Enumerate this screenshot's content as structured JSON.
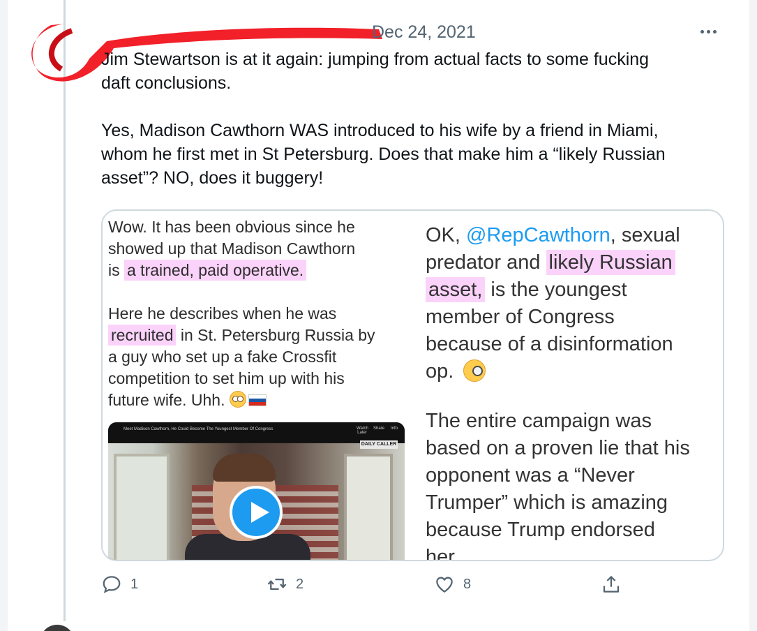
{
  "tweet": {
    "date": "Dec 24, 2021",
    "text_lines_p1": [
      "Jim Stewartson is at it again: jumping from actual facts to some fucking",
      "daft conclusions."
    ],
    "text_lines_p2": [
      "Yes, Madison Cawthorn WAS introduced to his wife by a friend in Miami,",
      "whom he first met in St Petersburg. Does that make him a “likely Russian",
      "asset”? NO, does it buggery!"
    ],
    "actions": {
      "reply_count": "1",
      "retweet_count": "2",
      "like_count": "8"
    }
  },
  "quoted_left": {
    "l1": "Wow. It has been obvious since he",
    "l2": "showed up that Madison Cawthorn",
    "l3_pre": "is ",
    "l3_hl": "a trained, paid operative.",
    "l4": "Here he describes when he was",
    "l5_hl": "recruited",
    "l5_post": " in St. Petersburg Russia by",
    "l6": "a guy who set up a fake Crossfit",
    "l7": "competition to set him up with his",
    "l8": "future wife. Uhh. "
  },
  "video": {
    "title": "Meet Madison Cawthorn, He Could Become The Youngest Member Of Congress",
    "ctrl_watch_later": "Watch Later",
    "ctrl_share": "Share",
    "ctrl_info": "Info",
    "badge": "DAILY CALLER"
  },
  "quoted_right": {
    "r1_pre": "OK, ",
    "r1_mention": "@RepCawthorn",
    "r1_post": ", sexual",
    "r2_pre": "predator and ",
    "r2_hl": "likely Russian",
    "r3_hl": "asset,",
    "r3_post": " is the youngest",
    "r4": "member of Congress",
    "r5": "because of a disinformation",
    "r6": "op. ",
    "r7": "The entire campaign was",
    "r8": "based on a proven lie that his",
    "r9": "opponent was a “Never",
    "r10": "Trumper” which is amazing",
    "r11": "because Trump endorsed",
    "r12": "her."
  },
  "colors": {
    "highlight": "#fbd3fa",
    "mention": "#1d9bf0",
    "muted_text": "#536471",
    "redaction": "#f0141e"
  },
  "icons": [
    "more-icon",
    "reply-icon",
    "retweet-icon",
    "like-icon",
    "share-icon",
    "play-icon",
    "flushed-face-emoji",
    "russia-flag-emoji",
    "monocle-face-emoji"
  ]
}
